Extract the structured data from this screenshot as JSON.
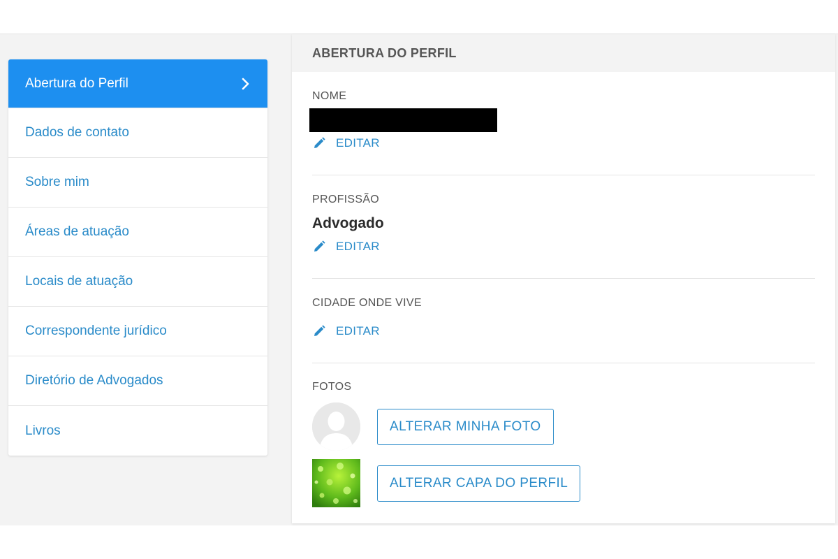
{
  "sidebar": {
    "items": [
      {
        "label": "Abertura do Perfil",
        "active": true
      },
      {
        "label": "Dados de contato"
      },
      {
        "label": "Sobre mim"
      },
      {
        "label": "Áreas de atuação"
      },
      {
        "label": "Locais de atuação"
      },
      {
        "label": "Correspondente jurídico"
      },
      {
        "label": "Diretório de Advogados"
      },
      {
        "label": "Livros"
      }
    ]
  },
  "panel": {
    "title": "ABERTURA DO PERFIL",
    "nome": {
      "label": "NOME",
      "edit": "EDITAR"
    },
    "profissao": {
      "label": "PROFISSÃO",
      "value": "Advogado",
      "edit": "EDITAR"
    },
    "cidade": {
      "label": "CIDADE ONDE VIVE",
      "edit": "EDITAR"
    },
    "fotos": {
      "label": "FOTOS",
      "change_photo": "ALTERAR MINHA FOTO",
      "change_cover": "ALTERAR CAPA DO PERFIL"
    }
  },
  "colors": {
    "accent": "#2a8bc9",
    "active_bg": "#1d8ff0",
    "background": "#f3f3f3"
  },
  "icons": {
    "chevron": "chevron-right-icon",
    "edit": "pencil-icon",
    "avatar": "user-silhouette-icon"
  }
}
